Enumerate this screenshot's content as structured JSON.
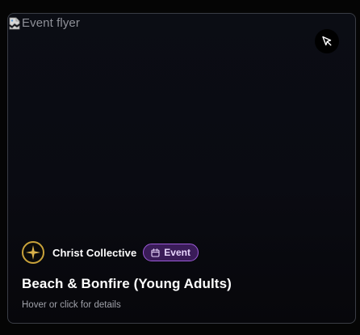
{
  "card": {
    "image_alt": "Event flyer",
    "organization": "Christ Collective",
    "badge_label": "Event",
    "title": "Beach & Bonfire (Young Adults)",
    "hint": "Hover or click for details"
  },
  "colors": {
    "badge_bg": "#3a1c58",
    "badge_border": "#9c5ad8",
    "logo_gold": "#c8a23a"
  },
  "icons": {
    "broken_image": "broken-image-icon",
    "pointer": "cursor-pointer-icon",
    "logo": "star-compass-logo",
    "badge": "calendar-icon"
  }
}
